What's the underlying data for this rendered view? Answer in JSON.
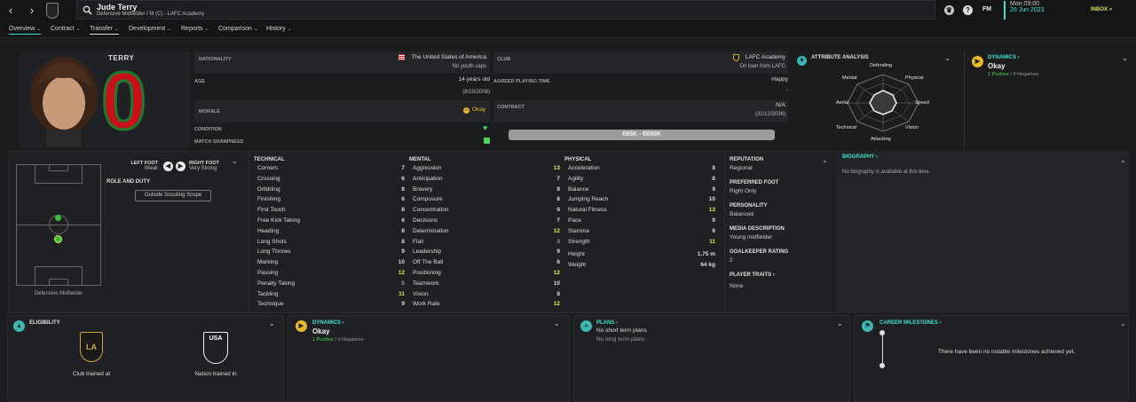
{
  "topbar": {
    "player_name": "Jude Terry",
    "player_sub": "Defensive Midfielder / M (C) - LAFC Academy",
    "time": "Mon 09:00",
    "date": "26 Jun 2023",
    "fm_label": "FM",
    "inbox_label": "INBOX"
  },
  "menu": [
    "Overview",
    "Contract",
    "Transfer",
    "Development",
    "Reports",
    "Comparison",
    "History"
  ],
  "profile": {
    "shirt_name": "TERRY",
    "shirt_number": "0",
    "nationality_label": "NATIONALITY",
    "nationality": "The United States of America",
    "youth_caps": "No youth caps",
    "club_label": "CLUB",
    "club": "LAFC Academy",
    "club_loan": "On loan from LAFC",
    "age_label": "AGE",
    "age": "14 years old",
    "dob": "(8/10/2008)",
    "playing_time_label": "AGREED PLAYING TIME",
    "playing_time": "Happy",
    "playing_time_sub": "-",
    "morale_label": "MORALE",
    "morale": "Okay",
    "contract_label": "CONTRACT",
    "contract": "N/A",
    "contract_date": "(31/12/2026)",
    "condition_label": "CONDITION",
    "sharpness_label": "MATCH SHARPNESS",
    "value": "€65K - €650K"
  },
  "attr_analysis": {
    "title": "ATTRIBUTE ANALYSIS",
    "labels": [
      "Defending",
      "Physical",
      "Speed",
      "Vision",
      "Attacking",
      "Technical",
      "Aerial",
      "Mental"
    ]
  },
  "dynamics": {
    "title": "DYNAMICS",
    "status": "Okay",
    "positive": "1 Positive",
    "negative": "0 Negatives"
  },
  "positions": {
    "left_foot_label": "LEFT FOOT",
    "left_foot": "Weak",
    "right_foot_label": "RIGHT FOOT",
    "right_foot": "Very Strong",
    "role_label": "ROLE AND DUTY",
    "scouting_btn": "Outside Scouting Scope",
    "position_caption": "Defensive Midfielder"
  },
  "technical": {
    "title": "TECHNICAL",
    "items": [
      {
        "name": "Corners",
        "v": "7"
      },
      {
        "name": "Crossing",
        "v": "6"
      },
      {
        "name": "Dribbling",
        "v": "8"
      },
      {
        "name": "Finishing",
        "v": "6"
      },
      {
        "name": "First Touch",
        "v": "8"
      },
      {
        "name": "Free Kick Taking",
        "v": "6"
      },
      {
        "name": "Heading",
        "v": "8"
      },
      {
        "name": "Long Shots",
        "v": "8"
      },
      {
        "name": "Long Throws",
        "v": "9"
      },
      {
        "name": "Marking",
        "v": "10"
      },
      {
        "name": "Passing",
        "v": "12"
      },
      {
        "name": "Penalty Taking",
        "v": "5"
      },
      {
        "name": "Tackling",
        "v": "11"
      },
      {
        "name": "Technique",
        "v": "9"
      }
    ]
  },
  "mental": {
    "title": "MENTAL",
    "items": [
      {
        "name": "Aggression",
        "v": "13"
      },
      {
        "name": "Anticipation",
        "v": "7"
      },
      {
        "name": "Bravery",
        "v": "8"
      },
      {
        "name": "Composure",
        "v": "8"
      },
      {
        "name": "Concentration",
        "v": "9"
      },
      {
        "name": "Decisions",
        "v": "7"
      },
      {
        "name": "Determination",
        "v": "12"
      },
      {
        "name": "Flair",
        "v": "3"
      },
      {
        "name": "Leadership",
        "v": "9"
      },
      {
        "name": "Off The Ball",
        "v": "6"
      },
      {
        "name": "Positioning",
        "v": "12"
      },
      {
        "name": "Teamwork",
        "v": "10"
      },
      {
        "name": "Vision",
        "v": "8"
      },
      {
        "name": "Work Rate",
        "v": "12"
      }
    ]
  },
  "physical": {
    "title": "PHYSICAL",
    "items": [
      {
        "name": "Acceleration",
        "v": "8"
      },
      {
        "name": "Agility",
        "v": "8"
      },
      {
        "name": "Balance",
        "v": "9"
      },
      {
        "name": "Jumping Reach",
        "v": "10"
      },
      {
        "name": "Natural Fitness",
        "v": "13"
      },
      {
        "name": "Pace",
        "v": "9"
      },
      {
        "name": "Stamina",
        "v": "8"
      },
      {
        "name": "Strength",
        "v": "11"
      }
    ],
    "height_label": "Height",
    "height": "1.75 m",
    "weight_label": "Weight",
    "weight": "64 kg"
  },
  "info": {
    "reputation_label": "REPUTATION",
    "reputation": "Regional",
    "foot_label": "PREFERRED FOOT",
    "foot": "Right Only",
    "personality_label": "PERSONALITY",
    "personality": "Balanced",
    "media_label": "MEDIA DESCRIPTION",
    "media": "Young midfielder",
    "gk_label": "GOALKEEPER RATING",
    "gk": "2",
    "traits_label": "PLAYER TRAITS",
    "traits": "None"
  },
  "biography": {
    "title": "BIOGRAPHY",
    "text": "No biography is available at this time."
  },
  "eligibility": {
    "title": "ELIGIBILITY",
    "club_caption": "Club trained at",
    "nation_caption": "Nation trained in"
  },
  "plans": {
    "title": "PLANS",
    "short": "No short term plans",
    "long": "No long term plans"
  },
  "milestones": {
    "title": "CAREER MILESTONES",
    "text": "There have been no notable milestones achieved yet."
  },
  "colors": {
    "accent": "#3de0d0",
    "highlight": "#e8e84a",
    "positive": "#52d45a",
    "okay": "#e8b92a"
  }
}
